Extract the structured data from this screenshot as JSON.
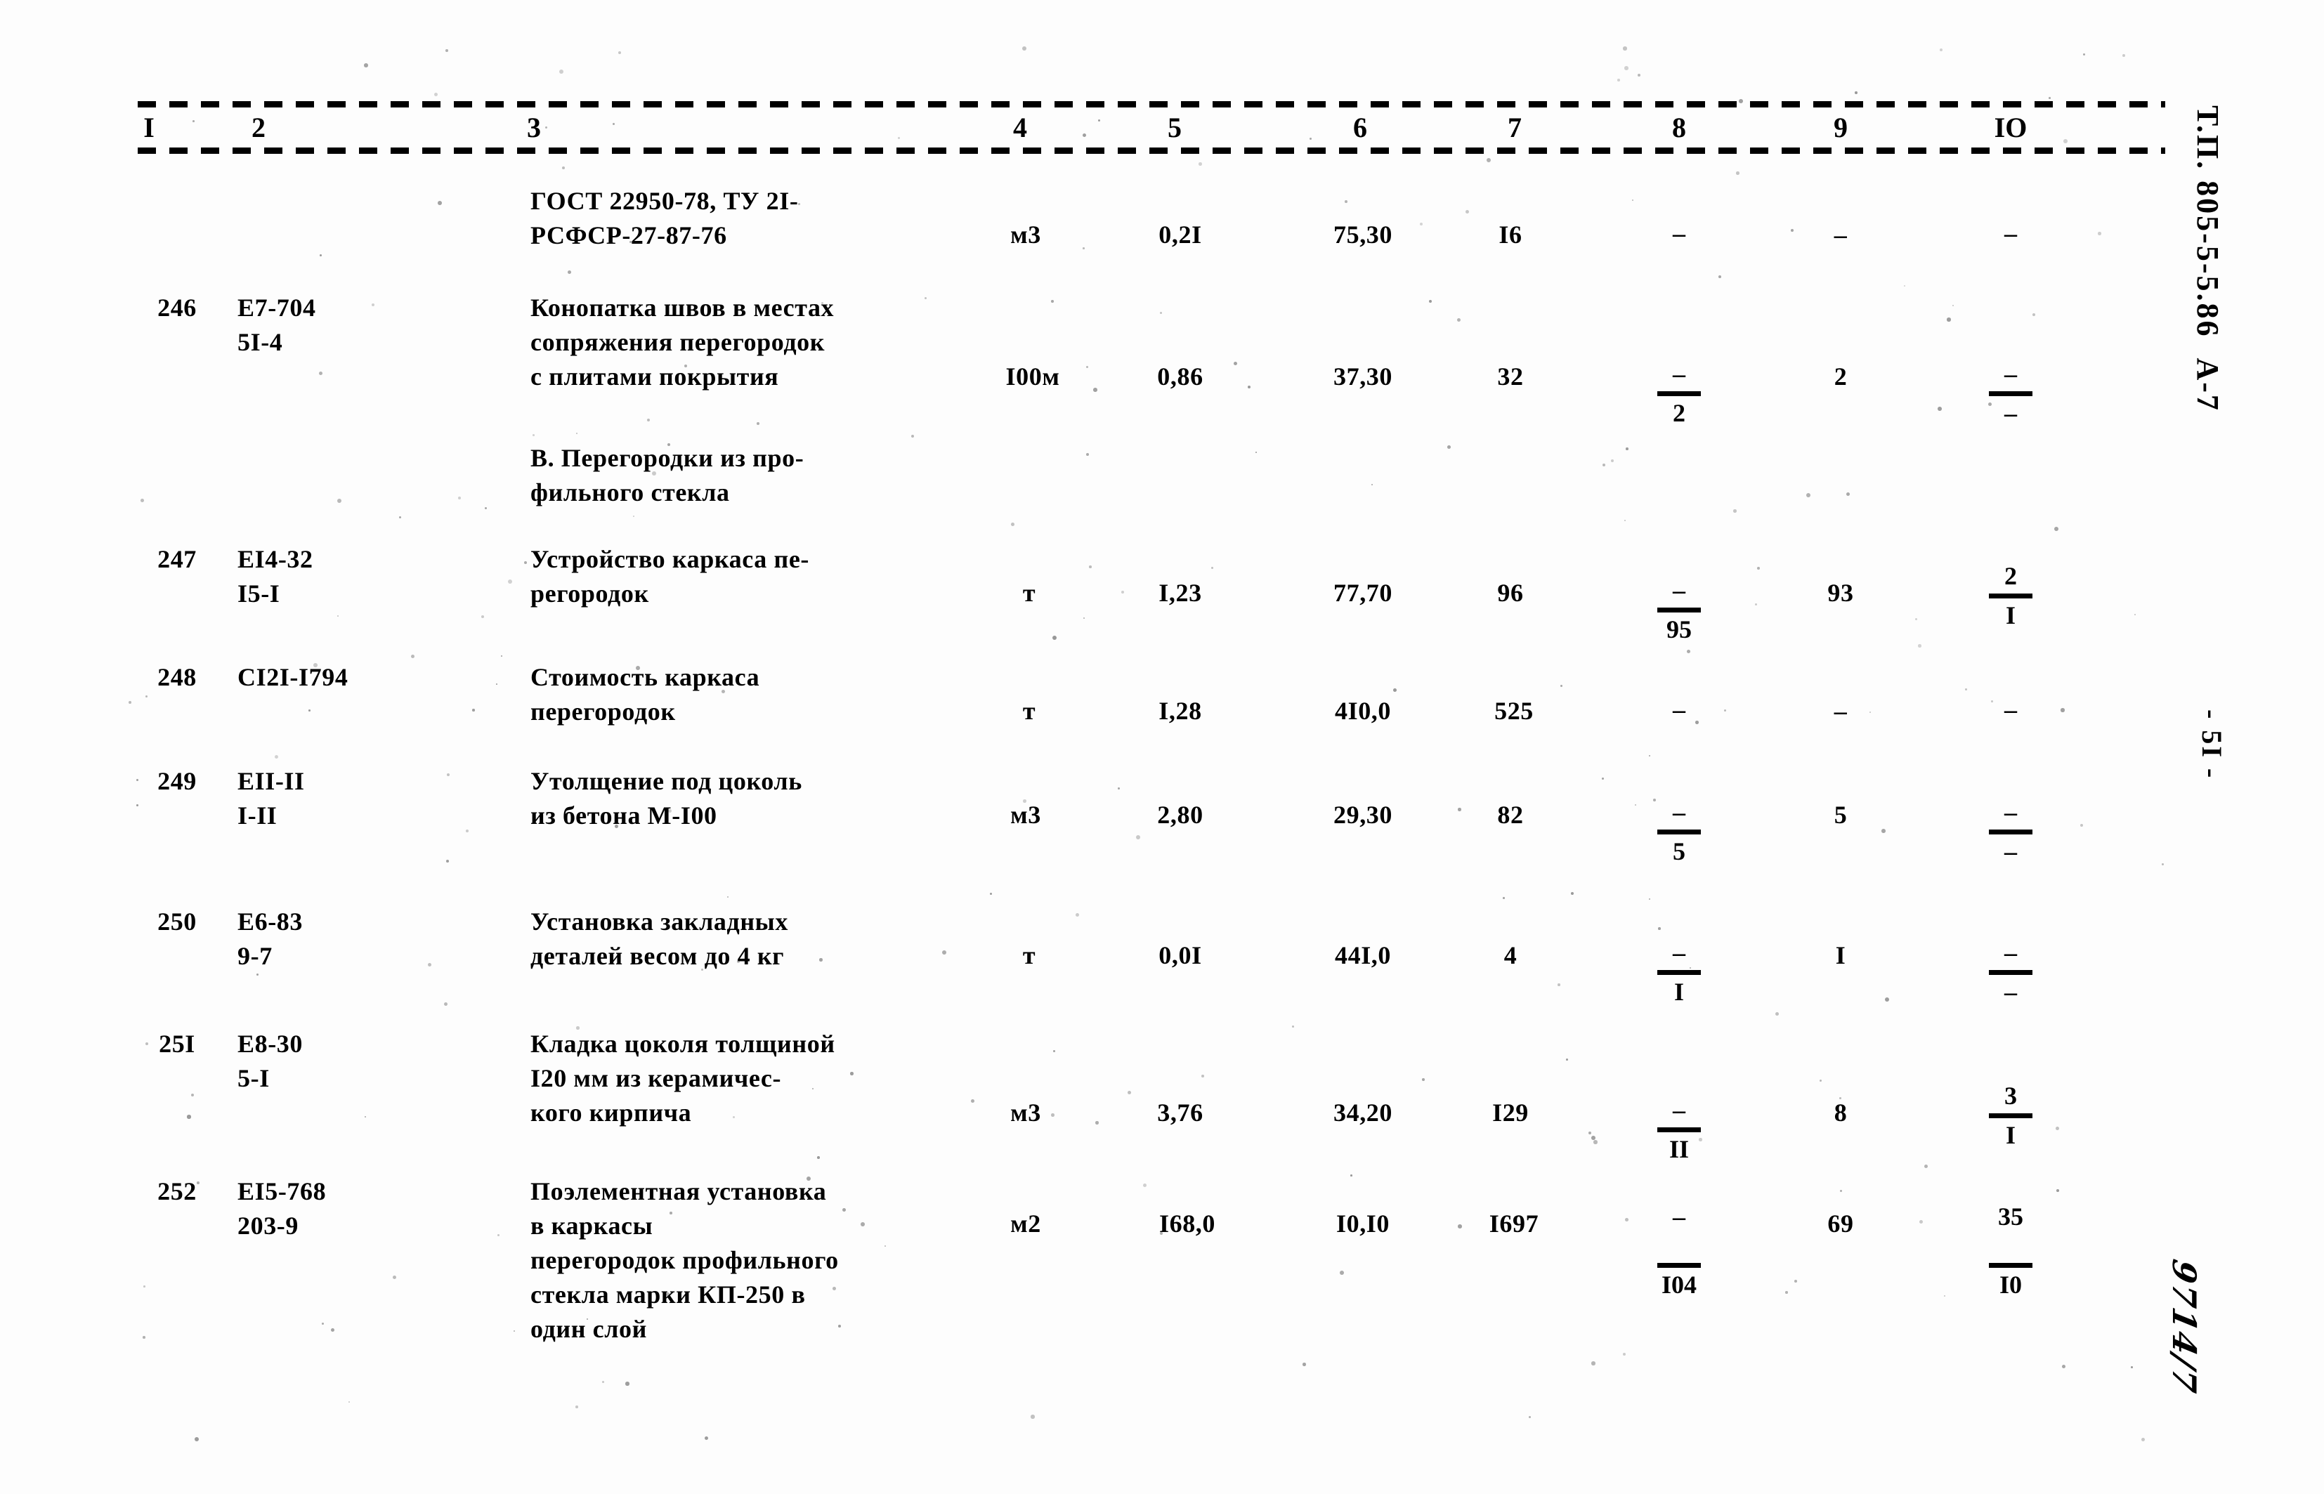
{
  "document": {
    "margin_code": "Т.П. 805-5-5.86  А-7",
    "page_number": "- 5I -",
    "handwritten_note": "9714/7"
  },
  "table": {
    "column_headers": [
      "I",
      "2",
      "3",
      "4",
      "5",
      "6",
      "7",
      "8",
      "9",
      "IO"
    ],
    "rows": [
      {
        "no": "",
        "code": "",
        "description": "ГОСТ 22950-78, ТУ 2I-\nРСФСР-27-87-76",
        "unit": "м3",
        "c5": "0,2I",
        "c6": "75,30",
        "c7": "I6",
        "c8_top": "–",
        "c8_bot": "",
        "c8_bar": false,
        "c9": "–",
        "c10_top": "–",
        "c10_bot": "",
        "c10_bar": false
      },
      {
        "no": "246",
        "code": "Е7-704\n5I-4",
        "description": "Конопатка швов в местах\nсопряжения перегородок\nс плитами покрытия",
        "unit": "I00м",
        "c5": "0,86",
        "c6": "37,30",
        "c7": "32",
        "c8_top": "–",
        "c8_bot": "2",
        "c8_bar": true,
        "c9": "2",
        "c10_top": "–",
        "c10_bot": "–",
        "c10_bar": true
      },
      {
        "no": "",
        "code": "",
        "description": "В. Перегородки из про-\nфильного стекла",
        "unit": "",
        "c5": "",
        "c6": "",
        "c7": "",
        "c8_top": "",
        "c8_bot": "",
        "c8_bar": false,
        "c9": "",
        "c10_top": "",
        "c10_bot": "",
        "c10_bar": false
      },
      {
        "no": "247",
        "code": "ЕI4-32\nI5-I",
        "description": "Устройство каркаса пе-\nрегородок",
        "unit": "т",
        "c5": "I,23",
        "c6": "77,70",
        "c7": "96",
        "c8_top": "–",
        "c8_bot": "95",
        "c8_bar": true,
        "c9": "93",
        "c10_top": "2",
        "c10_bot": "I",
        "c10_bar": true
      },
      {
        "no": "248",
        "code": "СI2I-I794",
        "description": "Стоимость каркаса\nперегородок",
        "unit": "т",
        "c5": "I,28",
        "c6": "4I0,0",
        "c7": "525",
        "c8_top": "–",
        "c8_bot": "",
        "c8_bar": false,
        "c9": "–",
        "c10_top": "–",
        "c10_bot": "",
        "c10_bar": false
      },
      {
        "no": "249",
        "code": "ЕII-II\nI-II",
        "description": "Утолщение под цоколь\nиз бетона М-I00",
        "unit": "м3",
        "c5": "2,80",
        "c6": "29,30",
        "c7": "82",
        "c8_top": "–",
        "c8_bot": "5",
        "c8_bar": true,
        "c9": "5",
        "c10_top": "–",
        "c10_bot": "–",
        "c10_bar": true
      },
      {
        "no": "250",
        "code": "Е6-83\n9-7",
        "description": "Установка закладных\nдеталей весом до 4 кг",
        "unit": "т",
        "c5": "0,0I",
        "c6": "44I,0",
        "c7": "4",
        "c8_top": "–",
        "c8_bot": "I",
        "c8_bar": true,
        "c9": "I",
        "c10_top": "–",
        "c10_bot": "–",
        "c10_bar": true
      },
      {
        "no": "25I",
        "code": "Е8-30\n5-I",
        "description": "Кладка цоколя толщиной\nI20 мм из керамичес-\nкого кирпича",
        "unit": "м3",
        "c5": "3,76",
        "c6": "34,20",
        "c7": "I29",
        "c8_top": "–",
        "c8_bot": "II",
        "c8_bar": true,
        "c9": "8",
        "c10_top": "3",
        "c10_bot": "I",
        "c10_bar": true
      },
      {
        "no": "252",
        "code": "ЕI5-768\n203-9",
        "description": "Поэлементная установка\nв каркасы\nперегородок профильного\nстекла марки КП-250 в\nодин слой",
        "unit": "м2",
        "c5": "I68,0",
        "c6": "I0,I0",
        "c7": "I697",
        "c8_top": "–",
        "c8_bot": "I04",
        "c8_bar": true,
        "c9": "69",
        "c10_top": "35",
        "c10_bot": "I0",
        "c10_bar": true
      }
    ]
  }
}
